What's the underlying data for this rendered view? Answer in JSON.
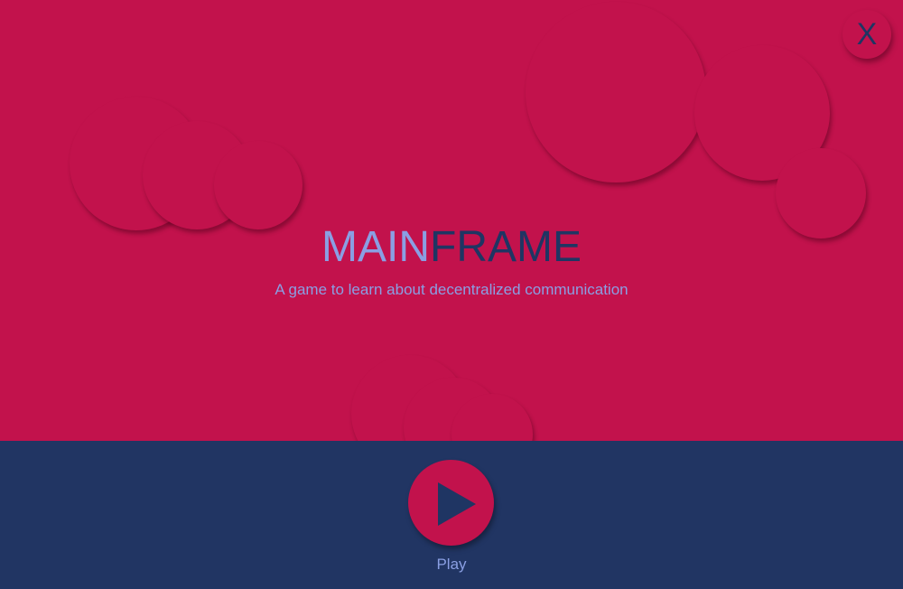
{
  "close_button": {
    "label": "X"
  },
  "title": {
    "part1": "MAIN",
    "part2": "FRAME"
  },
  "subtitle": "A game to learn about decentralized communication",
  "play_button": {
    "label": "Play"
  },
  "colors": {
    "background": "#c2124c",
    "footer": "#213563",
    "accent_light": "#8a9fe3",
    "accent_dark": "#1f3563"
  },
  "icons": {
    "play": "play-triangle-icon"
  }
}
